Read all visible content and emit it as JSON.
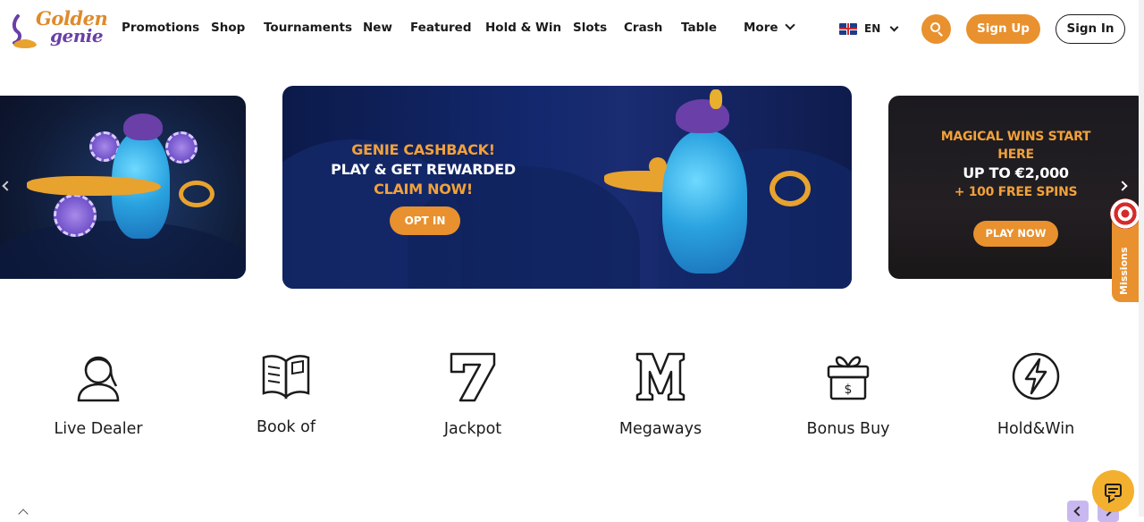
{
  "brand": {
    "logo_line1": "Golden",
    "logo_line2": "genie",
    "primary_color": "#e8912e",
    "secondary_color": "#6a3fa8"
  },
  "nav": {
    "items": [
      {
        "label": "Promotions"
      },
      {
        "label": "Shop"
      },
      {
        "label": "Tournaments"
      },
      {
        "label": "New"
      },
      {
        "label": "Featured"
      },
      {
        "label": "Hold & Win"
      },
      {
        "label": "Slots"
      },
      {
        "label": "Crash"
      },
      {
        "label": "Table"
      }
    ],
    "more_label": "More"
  },
  "language": {
    "code": "EN",
    "flag_icon": "uk-flag-icon"
  },
  "header_actions": {
    "search_icon": "search-icon",
    "signup_label": "Sign Up",
    "signin_label": "Sign In"
  },
  "carousel": {
    "main_slide": {
      "line1": "GENIE CASHBACK!",
      "line2": "PLAY & GET REWARDED",
      "line3": "CLAIM NOW!",
      "button_label": "OPT IN"
    },
    "right_slide": {
      "line1": "MAGICAL WINS START",
      "line2": "HERE",
      "line3": "UP TO €2,000",
      "line4": "+ 100 FREE SPINS",
      "button_label": "PLAY NOW"
    }
  },
  "missions": {
    "label": "Missions"
  },
  "categories": [
    {
      "label": "Live Dealer",
      "icon": "live-dealer-icon"
    },
    {
      "label": "Book of",
      "icon": "book-icon"
    },
    {
      "label": "Jackpot",
      "icon": "seven-icon"
    },
    {
      "label": "Megaways",
      "icon": "megaways-m-icon"
    },
    {
      "label": "Bonus Buy",
      "icon": "gift-dollar-icon"
    },
    {
      "label": "Hold&Win",
      "icon": "lightning-icon"
    }
  ]
}
